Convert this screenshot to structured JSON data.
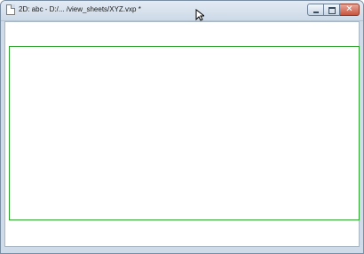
{
  "window": {
    "title": "2D: abc - D:/... /view_sheets/XYZ.vxp *",
    "icon": "document-icon",
    "controls": {
      "minimize_icon": "minimize-icon",
      "maximize_icon": "maximize-icon",
      "close_icon": "close-icon",
      "close_glyph": "✕"
    }
  },
  "canvas": {
    "frame_color": "#2fa52f",
    "background": "#ffffff"
  },
  "colors": {
    "titlebar": "#ccd9e7",
    "close_button": "#c7543e"
  }
}
